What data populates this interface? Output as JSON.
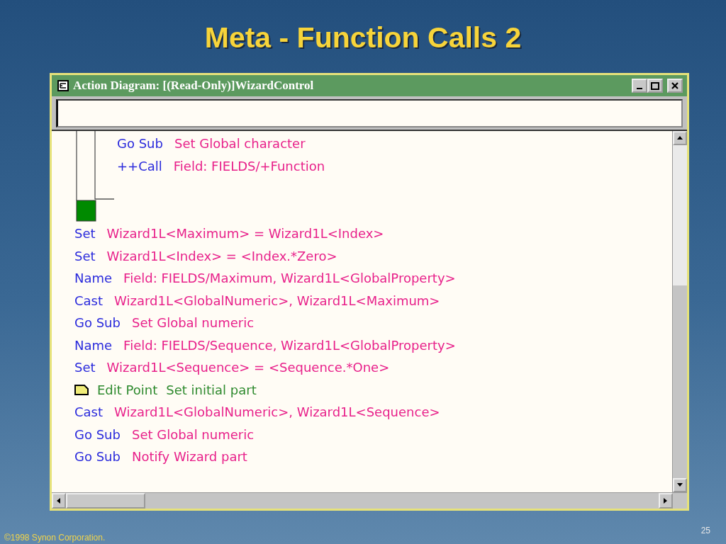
{
  "slide": {
    "title": "Meta - Function Calls 2",
    "footer": "©1998 Synon Corporation.",
    "page_number": "25"
  },
  "window": {
    "title": "Action Diagram:  [(Read-Only)]WizardControl",
    "nested": [
      {
        "keyword": "Go Sub",
        "text": "Set Global character"
      },
      {
        "keyword": "++Call",
        "text": "Field: FIELDS/+Function"
      }
    ],
    "statements": [
      {
        "kind": "statement",
        "keyword": "Set",
        "text": "Wizard1L<Maximum> = Wizard1L<Index>"
      },
      {
        "kind": "statement",
        "keyword": "Set",
        "text": "Wizard1L<Index> = <Index.*Zero>"
      },
      {
        "kind": "statement",
        "keyword": "Name",
        "text": "Field: FIELDS/Maximum, Wizard1L<GlobalProperty>"
      },
      {
        "kind": "statement",
        "keyword": "Cast",
        "text": "Wizard1L<GlobalNumeric>, Wizard1L<Maximum>"
      },
      {
        "kind": "statement",
        "keyword": "Go Sub",
        "text": "Set Global numeric"
      },
      {
        "kind": "statement",
        "keyword": "Name",
        "text": "Field: FIELDS/Sequence, Wizard1L<GlobalProperty>"
      },
      {
        "kind": "statement",
        "keyword": "Set",
        "text": "Wizard1L<Sequence> = <Sequence.*One>"
      },
      {
        "kind": "edit_point",
        "keyword": "Edit Point",
        "text": "Set initial part"
      },
      {
        "kind": "statement",
        "keyword": "Cast",
        "text": "Wizard1L<GlobalNumeric>, Wizard1L<Sequence>"
      },
      {
        "kind": "statement",
        "keyword": "Go Sub",
        "text": "Set Global numeric"
      },
      {
        "kind": "statement",
        "keyword": "Go Sub",
        "text": "Notify Wizard part"
      }
    ]
  }
}
